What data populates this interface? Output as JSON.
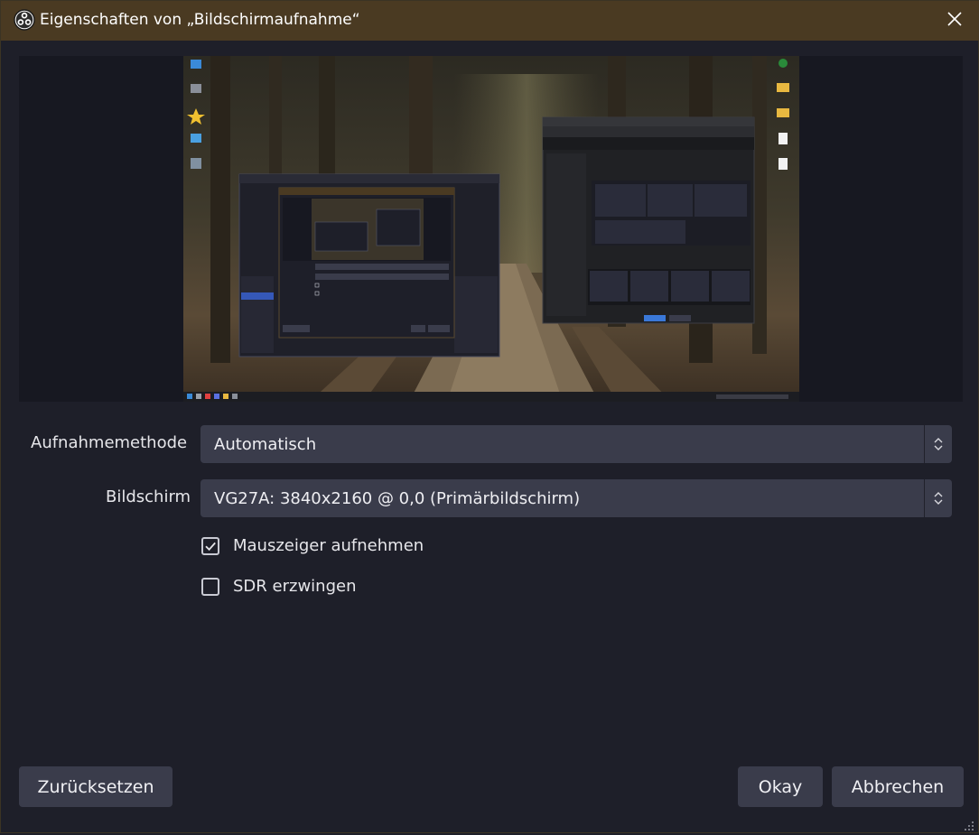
{
  "window": {
    "title": "Eigenschaften von „Bildschirmaufnahme“"
  },
  "preview": {
    "description_icon": "desktop-screen-capture-preview"
  },
  "form": {
    "capture_method": {
      "label": "Aufnahmemethode",
      "value": "Automatisch"
    },
    "display": {
      "label": "Bildschirm",
      "value": "VG27A: 3840x2160 @ 0,0 (Primärbildschirm)"
    },
    "capture_cursor": {
      "label": "Mauszeiger aufnehmen",
      "checked": true
    },
    "force_sdr": {
      "label": "SDR erzwingen",
      "checked": false
    }
  },
  "buttons": {
    "reset": "Zurücksetzen",
    "ok": "Okay",
    "cancel": "Abbrechen"
  },
  "colors": {
    "titlebar": "#4a3a22",
    "background": "#1e1f29",
    "control": "#3a3c4b"
  }
}
